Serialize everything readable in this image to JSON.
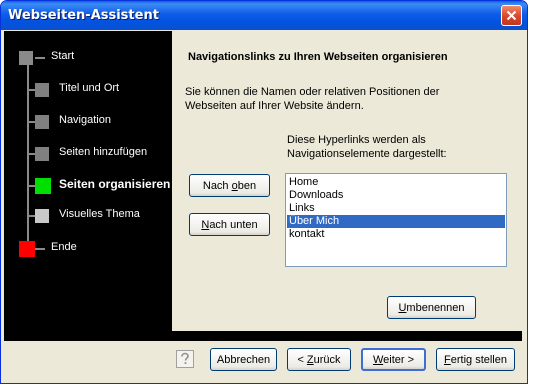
{
  "window": {
    "title": "Webseiten-Assistent"
  },
  "steps": [
    {
      "label": "Start",
      "state": "done",
      "color": "#8a8a8a"
    },
    {
      "label": "Titel und Ort",
      "state": "done",
      "color": "#808080"
    },
    {
      "label": "Navigation",
      "state": "done",
      "color": "#808080"
    },
    {
      "label": "Seiten hinzufügen",
      "state": "done",
      "color": "#808080"
    },
    {
      "label": "Seiten organisieren",
      "state": "current",
      "color": "#00e000"
    },
    {
      "label": "Visuelles Thema",
      "state": "pending",
      "color": "#c8c8c8"
    },
    {
      "label": "Ende",
      "state": "end",
      "color": "#ff0000"
    }
  ],
  "content": {
    "heading": "Navigationslinks zu Ihren Webseiten organisieren",
    "description": "Sie können die Namen oder relativen Positionen der Webseiten auf Ihrer Website ändern.",
    "list_caption": "Diese Hyperlinks werden als Navigationselemente dargestellt:",
    "move_up": {
      "label": "Nach oben",
      "accel": "o"
    },
    "move_down": {
      "label": "Nach unten",
      "accel": "N"
    },
    "rename": {
      "label": "Umbenennen",
      "accel": "U"
    },
    "list_items": [
      "Home",
      "Downloads",
      "Links",
      "Über Mich",
      "kontakt"
    ],
    "selected_index": 3
  },
  "footer": {
    "cancel": {
      "label": "Abbrechen"
    },
    "back": {
      "label": "< Zurück",
      "accel": "Z"
    },
    "next": {
      "label": "Weiter >",
      "accel": "W"
    },
    "finish": {
      "label": "Fertig stellen",
      "accel": "F"
    },
    "help_icon": "help-question-icon"
  },
  "colors": {
    "titlebar": "#0054e3",
    "selection": "#316ac5",
    "close": "#d8452b"
  }
}
